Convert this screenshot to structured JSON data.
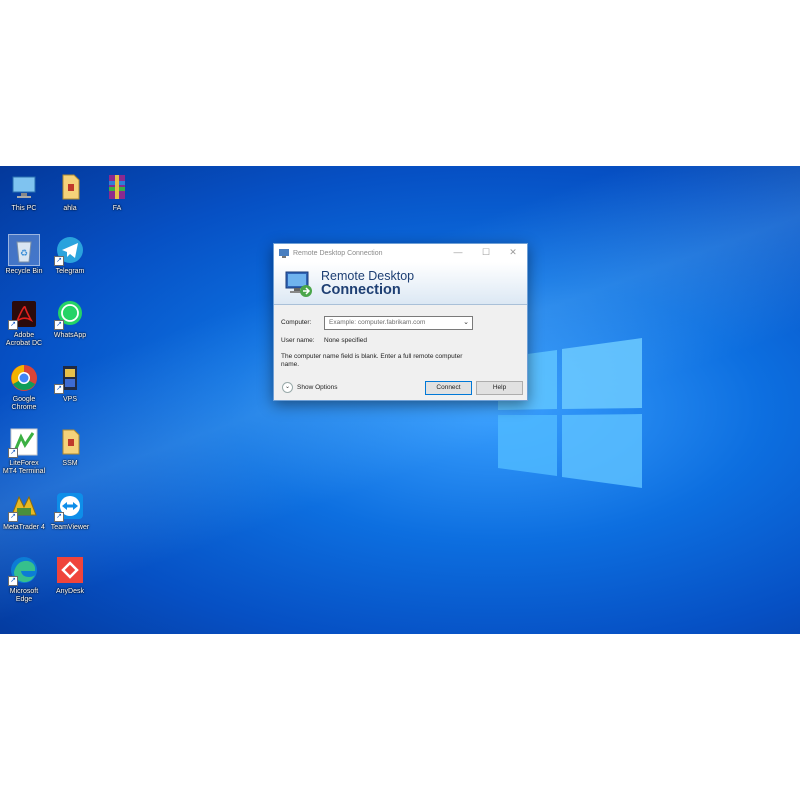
{
  "desktop": {
    "icons": [
      {
        "label": "This PC"
      },
      {
        "label": "ahla"
      },
      {
        "label": "FA"
      },
      {
        "label": "Recycle Bin"
      },
      {
        "label": "Telegram"
      },
      {
        "label": "Adobe\nAcrobat DC"
      },
      {
        "label": "WhatsApp"
      },
      {
        "label": "Google\nChrome"
      },
      {
        "label": "VPS"
      },
      {
        "label": "LiteForex\nMT4 Terminal"
      },
      {
        "label": "SSM"
      },
      {
        "label": "MetaTrader 4"
      },
      {
        "label": "TeamViewer"
      },
      {
        "label": "Microsoft\nEdge"
      },
      {
        "label": "AnyDesk"
      }
    ]
  },
  "dialog": {
    "title": "Remote Desktop Connection",
    "banner_line1": "Remote Desktop",
    "banner_line2": "Connection",
    "computer_label": "Computer:",
    "computer_placeholder": "Example: computer.fabrikam.com",
    "username_label": "User name:",
    "username_value": "None specified",
    "message": "The computer name field is blank. Enter a full remote computer name.",
    "show_options": "Show Options",
    "connect_label": "Connect",
    "help_label": "Help",
    "minimize_glyph": "—",
    "maximize_glyph": "☐",
    "close_glyph": "✕"
  }
}
